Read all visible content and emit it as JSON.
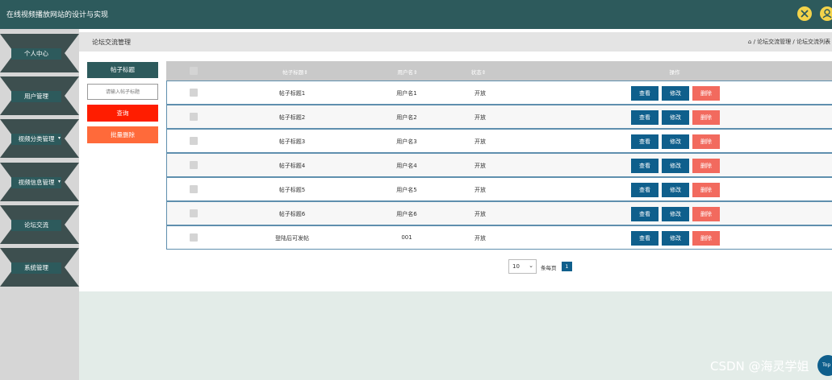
{
  "header": {
    "title": "在线视频播放网站的设计与实现",
    "icons": [
      "expand-icon",
      "user-icon"
    ]
  },
  "sidebar": {
    "items": [
      {
        "label": "个人中心",
        "caret": false
      },
      {
        "label": "用户管理",
        "caret": false
      },
      {
        "label": "视频分类管理",
        "caret": true
      },
      {
        "label": "视频信息管理",
        "caret": true
      },
      {
        "label": "论坛交流",
        "caret": false
      },
      {
        "label": "系统管理",
        "caret": false
      }
    ]
  },
  "breadcrumb": {
    "page_title": "论坛交流管理",
    "trail": "/ 论坛交流管理 / 论坛交流列表"
  },
  "search": {
    "label": "帖子标题",
    "placeholder": "请输入帖子标题",
    "query_button": "查询",
    "batch_delete_button": "批量删除"
  },
  "table": {
    "headers": [
      "帖子标题",
      "用户名",
      "状态",
      "操作"
    ],
    "rows": [
      {
        "title": "帖子标题1",
        "user": "用户名1",
        "status": "开放"
      },
      {
        "title": "帖子标题2",
        "user": "用户名2",
        "status": "开放"
      },
      {
        "title": "帖子标题3",
        "user": "用户名3",
        "status": "开放"
      },
      {
        "title": "帖子标题4",
        "user": "用户名4",
        "status": "开放"
      },
      {
        "title": "帖子标题5",
        "user": "用户名5",
        "status": "开放"
      },
      {
        "title": "帖子标题6",
        "user": "用户名6",
        "status": "开放"
      },
      {
        "title": "登陆后可发帖",
        "user": "001",
        "status": "开放"
      }
    ],
    "actions": {
      "view": "查看",
      "edit": "修改",
      "delete": "删除"
    }
  },
  "pagination": {
    "page_size": "10",
    "per_page_text": "条每页",
    "current_page": "1"
  },
  "watermark": "CSDN @海灵学姐",
  "top_button": "Top",
  "colors": {
    "header": "#2d5a5c",
    "primary": "#0f5f8c",
    "query": "#ff1d00",
    "batch_delete": "#ff6a3a",
    "delete": "#f26a5e"
  }
}
